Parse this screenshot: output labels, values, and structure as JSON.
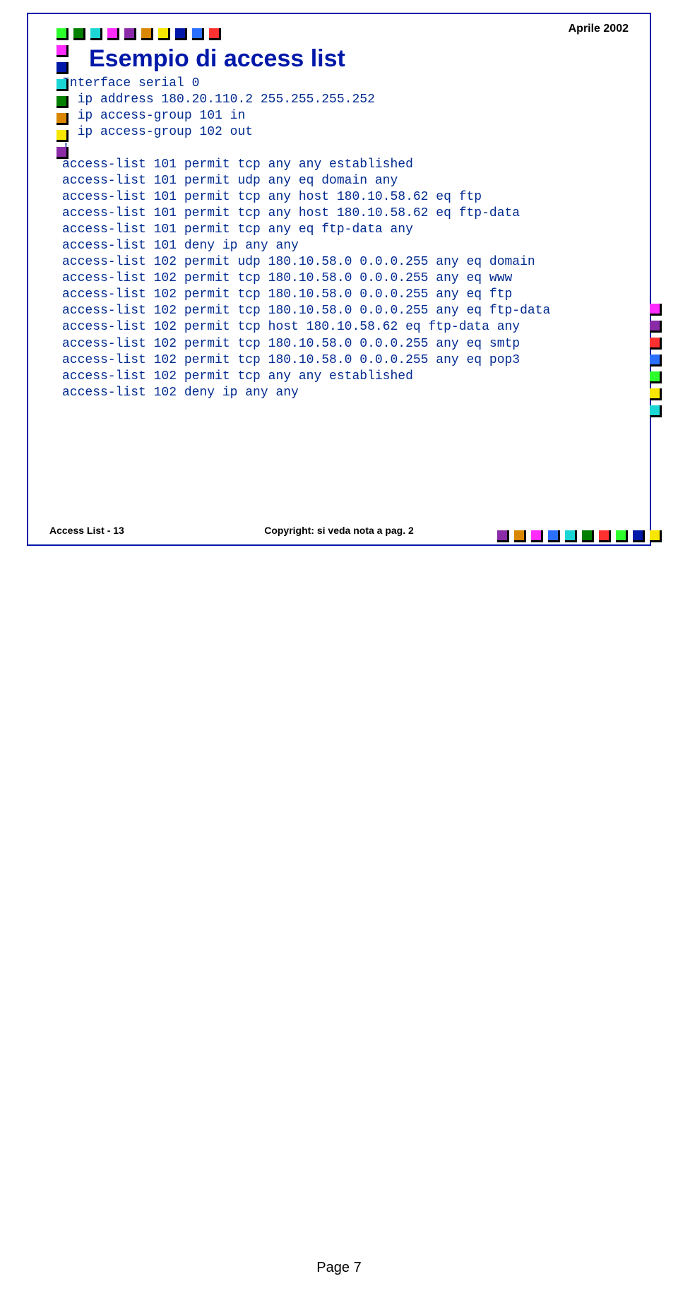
{
  "header": {
    "date": "Aprile 2002"
  },
  "title": "Esempio di access list",
  "code_lines": [
    "Interface serial 0",
    "  ip address 180.20.110.2 255.255.255.252",
    "  ip access-group 101 in",
    "  ip access-group 102 out",
    "!",
    "access-list 101 permit tcp any any established",
    "access-list 101 permit udp any eq domain any",
    "access-list 101 permit tcp any host 180.10.58.62 eq ftp",
    "access-list 101 permit tcp any host 180.10.58.62 eq ftp-data",
    "access-list 101 permit tcp any eq ftp-data any",
    "access-list 101 deny ip any any",
    "access-list 102 permit udp 180.10.58.0 0.0.0.255 any eq domain",
    "access-list 102 permit tcp 180.10.58.0 0.0.0.255 any eq www",
    "access-list 102 permit tcp 180.10.58.0 0.0.0.255 any eq ftp",
    "access-list 102 permit tcp 180.10.58.0 0.0.0.255 any eq ftp-data",
    "access-list 102 permit tcp host 180.10.58.62 eq ftp-data any",
    "access-list 102 permit tcp 180.10.58.0 0.0.0.255 any eq smtp",
    "access-list 102 permit tcp 180.10.58.0 0.0.0.255 any eq pop3",
    "access-list 102 permit tcp any any established",
    "access-list 102 deny ip any any"
  ],
  "footer": {
    "left": "Access List - 13",
    "center": "Copyright: si veda nota a pag. 2"
  },
  "page_label": "Page 7",
  "colors": {
    "bright_green": "#2cff2c",
    "dark_green": "#007f00",
    "cyan": "#1cd6d6",
    "magenta": "#ff2bff",
    "purple": "#8a2ba8",
    "orange": "#d98600",
    "yellow": "#f7e600",
    "navy": "#0018a8",
    "blue": "#2b6fff",
    "red": "#ff3030"
  }
}
